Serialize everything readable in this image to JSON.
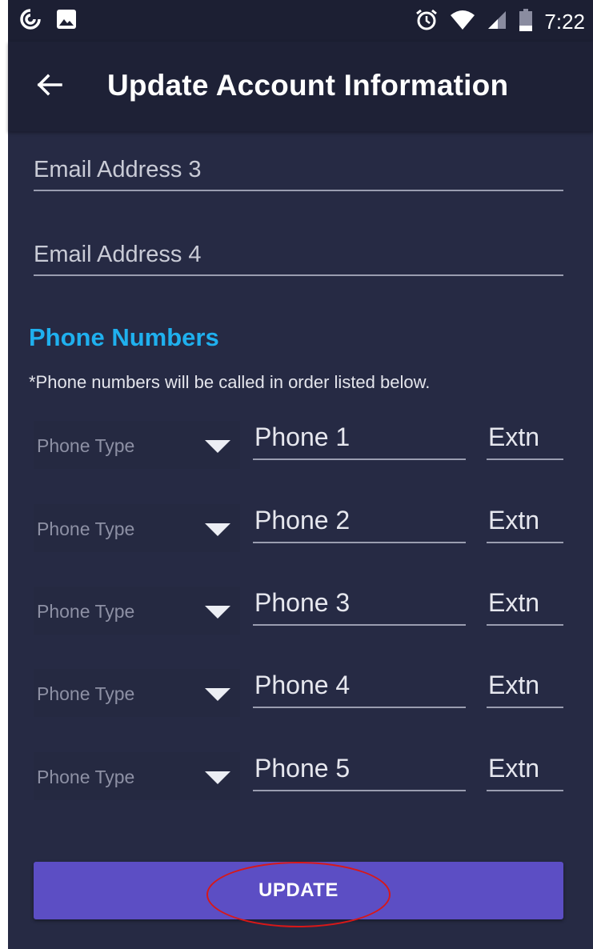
{
  "status_bar": {
    "time": "7:22",
    "left_icons": [
      "sync-icon",
      "image-icon"
    ],
    "right_icons": [
      "alarm-icon",
      "wifi-icon",
      "signal-icon",
      "battery-icon"
    ]
  },
  "app_bar": {
    "title": "Update Account Information",
    "back_icon": "arrow-left-icon"
  },
  "email_fields": [
    {
      "placeholder": "Email Address 3",
      "value": ""
    },
    {
      "placeholder": "Email Address 4",
      "value": ""
    }
  ],
  "phone_section": {
    "title": "Phone Numbers",
    "note": "*Phone numbers will be called in order listed below.",
    "rows": [
      {
        "type_placeholder": "Phone Type",
        "phone_placeholder": "Phone 1",
        "ext_placeholder": "Extn"
      },
      {
        "type_placeholder": "Phone Type",
        "phone_placeholder": "Phone 2",
        "ext_placeholder": "Extn"
      },
      {
        "type_placeholder": "Phone Type",
        "phone_placeholder": "Phone 3",
        "ext_placeholder": "Extn"
      },
      {
        "type_placeholder": "Phone Type",
        "phone_placeholder": "Phone 4",
        "ext_placeholder": "Extn"
      },
      {
        "type_placeholder": "Phone Type",
        "phone_placeholder": "Phone 5",
        "ext_placeholder": "Extn"
      }
    ]
  },
  "update_button": {
    "label": "UPDATE"
  },
  "colors": {
    "background": "#262a44",
    "app_bar": "#1e2136",
    "accent_section": "#1fb0ee",
    "button": "#5c4ec4",
    "annotation": "#d81818"
  }
}
